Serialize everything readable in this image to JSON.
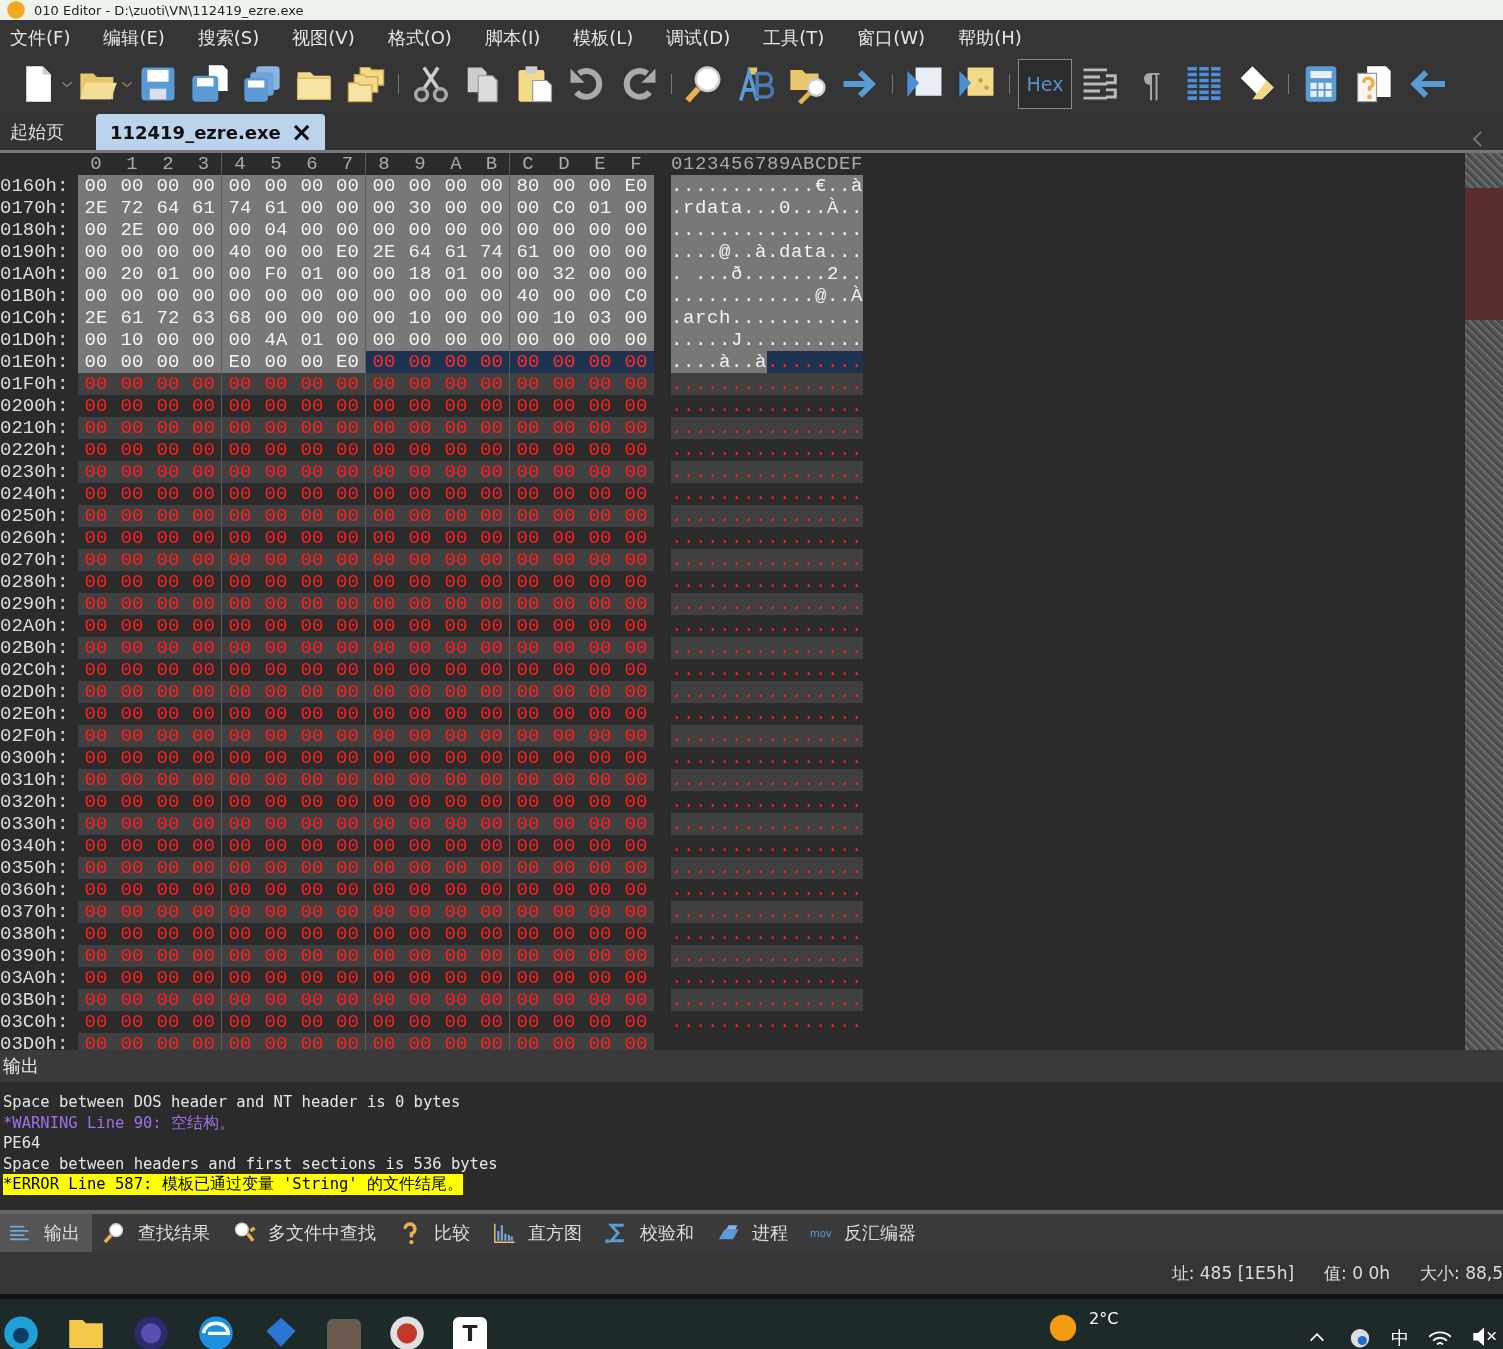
{
  "window": {
    "title": "010 Editor - D:\\zuoti\\VN\\112419_ezre.exe"
  },
  "menu": [
    "文件(F)",
    "编辑(E)",
    "搜索(S)",
    "视图(V)",
    "格式(O)",
    "脚本(I)",
    "模板(L)",
    "调试(D)",
    "工具(T)",
    "窗口(W)",
    "帮助(H)"
  ],
  "toolbar": {
    "hex_button": {
      "label": "Hex",
      "on": true
    },
    "pilcrow": "¶"
  },
  "tabs": [
    {
      "label": "起始页",
      "selected": false
    },
    {
      "label": "112419_ezre.exe",
      "selected": true,
      "close_glyph": "×"
    }
  ],
  "hex": {
    "columns": [
      "0",
      "1",
      "2",
      "3",
      "4",
      "5",
      "6",
      "7",
      "8",
      "9",
      "A",
      "B",
      "C",
      "D",
      "E",
      "F"
    ],
    "ascii_header": "0123456789ABCDEF",
    "rows": [
      {
        "offset": "0160h:",
        "segments": [
          {
            "kind": "template",
            "bytes": [
              "00",
              "00",
              "00",
              "00",
              "00",
              "00",
              "00",
              "00",
              "00",
              "00",
              "00",
              "00",
              "80",
              "00",
              "00",
              "E0"
            ],
            "ascii": "............€..à"
          }
        ]
      },
      {
        "offset": "0170h:",
        "segments": [
          {
            "kind": "template",
            "bytes": [
              "2E",
              "72",
              "64",
              "61",
              "74",
              "61",
              "00",
              "00",
              "00",
              "30",
              "00",
              "00",
              "00",
              "C0",
              "01",
              "00"
            ],
            "ascii": ".rdata...0...À.."
          }
        ]
      },
      {
        "offset": "0180h:",
        "segments": [
          {
            "kind": "template",
            "bytes": [
              "00",
              "2E",
              "00",
              "00",
              "00",
              "04",
              "00",
              "00",
              "00",
              "00",
              "00",
              "00",
              "00",
              "00",
              "00",
              "00"
            ],
            "ascii": "................"
          }
        ]
      },
      {
        "offset": "0190h:",
        "segments": [
          {
            "kind": "template",
            "bytes": [
              "00",
              "00",
              "00",
              "00",
              "40",
              "00",
              "00",
              "E0",
              "2E",
              "64",
              "61",
              "74",
              "61",
              "00",
              "00",
              "00"
            ],
            "ascii": "....@..à.data..."
          }
        ]
      },
      {
        "offset": "01A0h:",
        "segments": [
          {
            "kind": "template",
            "bytes": [
              "00",
              "20",
              "01",
              "00",
              "00",
              "F0",
              "01",
              "00",
              "00",
              "18",
              "01",
              "00",
              "00",
              "32",
              "00",
              "00"
            ],
            "ascii": ". ...ð.......2.."
          }
        ]
      },
      {
        "offset": "01B0h:",
        "segments": [
          {
            "kind": "template",
            "bytes": [
              "00",
              "00",
              "00",
              "00",
              "00",
              "00",
              "00",
              "00",
              "00",
              "00",
              "00",
              "00",
              "40",
              "00",
              "00",
              "C0"
            ],
            "ascii": "............@..À"
          }
        ]
      },
      {
        "offset": "01C0h:",
        "segments": [
          {
            "kind": "template",
            "bytes": [
              "2E",
              "61",
              "72",
              "63",
              "68",
              "00",
              "00",
              "00",
              "00",
              "10",
              "00",
              "00",
              "00",
              "10",
              "03",
              "00"
            ],
            "ascii": ".arch..........."
          }
        ]
      },
      {
        "offset": "01D0h:",
        "segments": [
          {
            "kind": "template",
            "bytes": [
              "00",
              "10",
              "00",
              "00",
              "00",
              "4A",
              "01",
              "00",
              "00",
              "00",
              "00",
              "00",
              "00",
              "00",
              "00",
              "00"
            ],
            "ascii": ".....J.........."
          }
        ]
      },
      {
        "offset": "01E0h:",
        "segments": [
          {
            "kind": "template",
            "bytes": [
              "00",
              "00",
              "00",
              "00",
              "E0",
              "00",
              "00",
              "E0"
            ],
            "ascii": "....à..à"
          },
          {
            "kind": "selected",
            "bytes": [
              "00",
              "00",
              "00",
              "00",
              "00",
              "00",
              "00",
              "00"
            ],
            "ascii": "........"
          }
        ]
      },
      {
        "offset": "01F0h:",
        "segments": [
          {
            "kind": "plain",
            "bytes": [
              "00",
              "00",
              "00",
              "00",
              "00",
              "00",
              "00",
              "00",
              "00",
              "00",
              "00",
              "00",
              "00",
              "00",
              "00",
              "00"
            ],
            "ascii": "................"
          }
        ]
      },
      {
        "offset": "0200h:",
        "segments": [
          {
            "kind": "plain",
            "bytes": [
              "00",
              "00",
              "00",
              "00",
              "00",
              "00",
              "00",
              "00",
              "00",
              "00",
              "00",
              "00",
              "00",
              "00",
              "00",
              "00"
            ],
            "ascii": "................"
          }
        ]
      },
      {
        "offset": "0210h:",
        "segments": [
          {
            "kind": "plain",
            "bytes": [
              "00",
              "00",
              "00",
              "00",
              "00",
              "00",
              "00",
              "00",
              "00",
              "00",
              "00",
              "00",
              "00",
              "00",
              "00",
              "00"
            ],
            "ascii": "................"
          }
        ]
      },
      {
        "offset": "0220h:",
        "segments": [
          {
            "kind": "plain",
            "bytes": [
              "00",
              "00",
              "00",
              "00",
              "00",
              "00",
              "00",
              "00",
              "00",
              "00",
              "00",
              "00",
              "00",
              "00",
              "00",
              "00"
            ],
            "ascii": "................"
          }
        ]
      },
      {
        "offset": "0230h:",
        "segments": [
          {
            "kind": "plain",
            "bytes": [
              "00",
              "00",
              "00",
              "00",
              "00",
              "00",
              "00",
              "00",
              "00",
              "00",
              "00",
              "00",
              "00",
              "00",
              "00",
              "00"
            ],
            "ascii": "................"
          }
        ]
      },
      {
        "offset": "0240h:",
        "segments": [
          {
            "kind": "plain",
            "bytes": [
              "00",
              "00",
              "00",
              "00",
              "00",
              "00",
              "00",
              "00",
              "00",
              "00",
              "00",
              "00",
              "00",
              "00",
              "00",
              "00"
            ],
            "ascii": "................"
          }
        ]
      },
      {
        "offset": "0250h:",
        "segments": [
          {
            "kind": "plain",
            "bytes": [
              "00",
              "00",
              "00",
              "00",
              "00",
              "00",
              "00",
              "00",
              "00",
              "00",
              "00",
              "00",
              "00",
              "00",
              "00",
              "00"
            ],
            "ascii": "................"
          }
        ]
      },
      {
        "offset": "0260h:",
        "segments": [
          {
            "kind": "plain",
            "bytes": [
              "00",
              "00",
              "00",
              "00",
              "00",
              "00",
              "00",
              "00",
              "00",
              "00",
              "00",
              "00",
              "00",
              "00",
              "00",
              "00"
            ],
            "ascii": "................"
          }
        ]
      },
      {
        "offset": "0270h:",
        "segments": [
          {
            "kind": "plain",
            "bytes": [
              "00",
              "00",
              "00",
              "00",
              "00",
              "00",
              "00",
              "00",
              "00",
              "00",
              "00",
              "00",
              "00",
              "00",
              "00",
              "00"
            ],
            "ascii": "................"
          }
        ]
      },
      {
        "offset": "0280h:",
        "segments": [
          {
            "kind": "plain",
            "bytes": [
              "00",
              "00",
              "00",
              "00",
              "00",
              "00",
              "00",
              "00",
              "00",
              "00",
              "00",
              "00",
              "00",
              "00",
              "00",
              "00"
            ],
            "ascii": "................"
          }
        ]
      },
      {
        "offset": "0290h:",
        "segments": [
          {
            "kind": "plain",
            "bytes": [
              "00",
              "00",
              "00",
              "00",
              "00",
              "00",
              "00",
              "00",
              "00",
              "00",
              "00",
              "00",
              "00",
              "00",
              "00",
              "00"
            ],
            "ascii": "................"
          }
        ]
      },
      {
        "offset": "02A0h:",
        "segments": [
          {
            "kind": "plain",
            "bytes": [
              "00",
              "00",
              "00",
              "00",
              "00",
              "00",
              "00",
              "00",
              "00",
              "00",
              "00",
              "00",
              "00",
              "00",
              "00",
              "00"
            ],
            "ascii": "................"
          }
        ]
      },
      {
        "offset": "02B0h:",
        "segments": [
          {
            "kind": "plain",
            "bytes": [
              "00",
              "00",
              "00",
              "00",
              "00",
              "00",
              "00",
              "00",
              "00",
              "00",
              "00",
              "00",
              "00",
              "00",
              "00",
              "00"
            ],
            "ascii": "................"
          }
        ]
      },
      {
        "offset": "02C0h:",
        "segments": [
          {
            "kind": "plain",
            "bytes": [
              "00",
              "00",
              "00",
              "00",
              "00",
              "00",
              "00",
              "00",
              "00",
              "00",
              "00",
              "00",
              "00",
              "00",
              "00",
              "00"
            ],
            "ascii": "................"
          }
        ]
      },
      {
        "offset": "02D0h:",
        "segments": [
          {
            "kind": "plain",
            "bytes": [
              "00",
              "00",
              "00",
              "00",
              "00",
              "00",
              "00",
              "00",
              "00",
              "00",
              "00",
              "00",
              "00",
              "00",
              "00",
              "00"
            ],
            "ascii": "................"
          }
        ]
      },
      {
        "offset": "02E0h:",
        "segments": [
          {
            "kind": "plain",
            "bytes": [
              "00",
              "00",
              "00",
              "00",
              "00",
              "00",
              "00",
              "00",
              "00",
              "00",
              "00",
              "00",
              "00",
              "00",
              "00",
              "00"
            ],
            "ascii": "................"
          }
        ]
      },
      {
        "offset": "02F0h:",
        "segments": [
          {
            "kind": "plain",
            "bytes": [
              "00",
              "00",
              "00",
              "00",
              "00",
              "00",
              "00",
              "00",
              "00",
              "00",
              "00",
              "00",
              "00",
              "00",
              "00",
              "00"
            ],
            "ascii": "................"
          }
        ]
      },
      {
        "offset": "0300h:",
        "segments": [
          {
            "kind": "plain",
            "bytes": [
              "00",
              "00",
              "00",
              "00",
              "00",
              "00",
              "00",
              "00",
              "00",
              "00",
              "00",
              "00",
              "00",
              "00",
              "00",
              "00"
            ],
            "ascii": "................"
          }
        ]
      },
      {
        "offset": "0310h:",
        "segments": [
          {
            "kind": "plain",
            "bytes": [
              "00",
              "00",
              "00",
              "00",
              "00",
              "00",
              "00",
              "00",
              "00",
              "00",
              "00",
              "00",
              "00",
              "00",
              "00",
              "00"
            ],
            "ascii": "................"
          }
        ]
      },
      {
        "offset": "0320h:",
        "segments": [
          {
            "kind": "plain",
            "bytes": [
              "00",
              "00",
              "00",
              "00",
              "00",
              "00",
              "00",
              "00",
              "00",
              "00",
              "00",
              "00",
              "00",
              "00",
              "00",
              "00"
            ],
            "ascii": "................"
          }
        ]
      },
      {
        "offset": "0330h:",
        "segments": [
          {
            "kind": "plain",
            "bytes": [
              "00",
              "00",
              "00",
              "00",
              "00",
              "00",
              "00",
              "00",
              "00",
              "00",
              "00",
              "00",
              "00",
              "00",
              "00",
              "00"
            ],
            "ascii": "................"
          }
        ]
      },
      {
        "offset": "0340h:",
        "segments": [
          {
            "kind": "plain",
            "bytes": [
              "00",
              "00",
              "00",
              "00",
              "00",
              "00",
              "00",
              "00",
              "00",
              "00",
              "00",
              "00",
              "00",
              "00",
              "00",
              "00"
            ],
            "ascii": "................"
          }
        ]
      },
      {
        "offset": "0350h:",
        "segments": [
          {
            "kind": "plain",
            "bytes": [
              "00",
              "00",
              "00",
              "00",
              "00",
              "00",
              "00",
              "00",
              "00",
              "00",
              "00",
              "00",
              "00",
              "00",
              "00",
              "00"
            ],
            "ascii": "................"
          }
        ]
      },
      {
        "offset": "0360h:",
        "segments": [
          {
            "kind": "plain",
            "bytes": [
              "00",
              "00",
              "00",
              "00",
              "00",
              "00",
              "00",
              "00",
              "00",
              "00",
              "00",
              "00",
              "00",
              "00",
              "00",
              "00"
            ],
            "ascii": "................"
          }
        ]
      },
      {
        "offset": "0370h:",
        "segments": [
          {
            "kind": "plain",
            "bytes": [
              "00",
              "00",
              "00",
              "00",
              "00",
              "00",
              "00",
              "00",
              "00",
              "00",
              "00",
              "00",
              "00",
              "00",
              "00",
              "00"
            ],
            "ascii": "................"
          }
        ]
      },
      {
        "offset": "0380h:",
        "segments": [
          {
            "kind": "plain",
            "bytes": [
              "00",
              "00",
              "00",
              "00",
              "00",
              "00",
              "00",
              "00",
              "00",
              "00",
              "00",
              "00",
              "00",
              "00",
              "00",
              "00"
            ],
            "ascii": "................"
          }
        ]
      },
      {
        "offset": "0390h:",
        "segments": [
          {
            "kind": "plain",
            "bytes": [
              "00",
              "00",
              "00",
              "00",
              "00",
              "00",
              "00",
              "00",
              "00",
              "00",
              "00",
              "00",
              "00",
              "00",
              "00",
              "00"
            ],
            "ascii": "................"
          }
        ]
      },
      {
        "offset": "03A0h:",
        "segments": [
          {
            "kind": "plain",
            "bytes": [
              "00",
              "00",
              "00",
              "00",
              "00",
              "00",
              "00",
              "00",
              "00",
              "00",
              "00",
              "00",
              "00",
              "00",
              "00",
              "00"
            ],
            "ascii": "................"
          }
        ]
      },
      {
        "offset": "03B0h:",
        "segments": [
          {
            "kind": "plain",
            "bytes": [
              "00",
              "00",
              "00",
              "00",
              "00",
              "00",
              "00",
              "00",
              "00",
              "00",
              "00",
              "00",
              "00",
              "00",
              "00",
              "00"
            ],
            "ascii": "................"
          }
        ]
      },
      {
        "offset": "03C0h:",
        "segments": [
          {
            "kind": "plain",
            "bytes": [
              "00",
              "00",
              "00",
              "00",
              "00",
              "00",
              "00",
              "00",
              "00",
              "00",
              "00",
              "00",
              "00",
              "00",
              "00",
              "00"
            ],
            "ascii": "................"
          }
        ]
      },
      {
        "offset": "03D0h:",
        "segments": [
          {
            "kind": "plain",
            "bytes": [
              "00",
              "00",
              "00",
              "00",
              "00",
              "00",
              "00",
              "00",
              "00",
              "00",
              "00",
              "00",
              "00",
              "00",
              "00",
              "00"
            ]
          }
        ]
      }
    ]
  },
  "output": {
    "title": "输出",
    "lines": [
      {
        "kind": "info",
        "text": "Space between DOS header and NT header is 0 bytes"
      },
      {
        "kind": "warning",
        "text": "*WARNING Line 90: 空结构。"
      },
      {
        "kind": "info",
        "text": "PE64"
      },
      {
        "kind": "info",
        "text": "Space between headers and first sections is 536 bytes"
      },
      {
        "kind": "error",
        "text": "*ERROR Line 587: 模板已通过变量 'String' 的文件结尾。"
      }
    ]
  },
  "bottom_tabs": [
    {
      "label": "输出",
      "selected": true
    },
    {
      "label": "查找结果",
      "selected": false
    },
    {
      "label": "多文件中查找",
      "selected": false
    },
    {
      "label": "比较",
      "selected": false
    },
    {
      "label": "直方图",
      "selected": false
    },
    {
      "label": "校验和",
      "selected": false
    },
    {
      "label": "进程",
      "selected": false
    },
    {
      "label": "反汇编器",
      "selected": false,
      "icon_label": "mov"
    }
  ],
  "status_bar": [
    "址: 485 [1E5h]",
    "值: 0 0h",
    "大小: 88,5"
  ],
  "taskbar": {
    "app_letter": "T",
    "weather": "2°C",
    "ime": "中"
  }
}
